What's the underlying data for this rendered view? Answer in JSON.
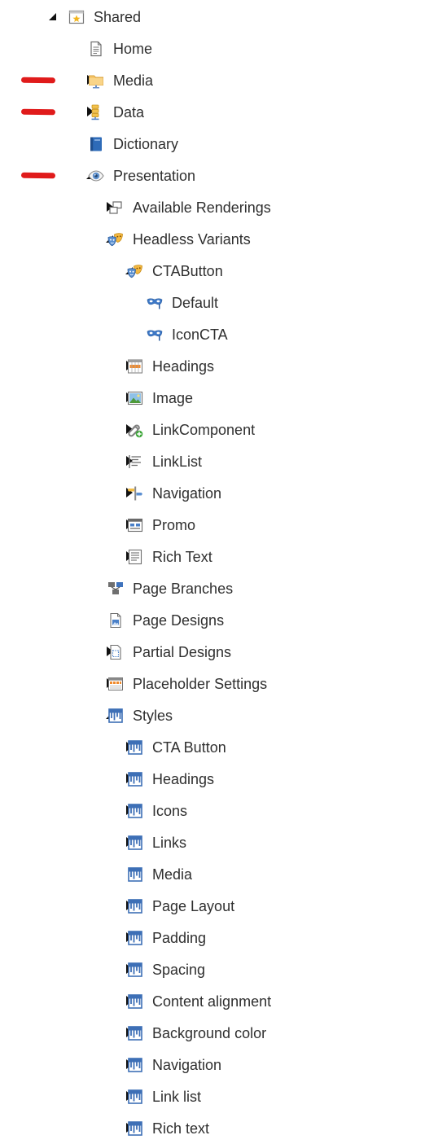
{
  "tree": [
    {
      "label": "Shared",
      "level": 0,
      "state": "expanded",
      "icon": "shared-star-icon"
    },
    {
      "label": "Home",
      "level": 1,
      "state": "none",
      "icon": "document-icon"
    },
    {
      "label": "Media",
      "level": 1,
      "state": "collapsed",
      "icon": "media-folder-icon",
      "marked": true
    },
    {
      "label": "Data",
      "level": 1,
      "state": "collapsed",
      "icon": "data-icon",
      "marked": true
    },
    {
      "label": "Dictionary",
      "level": 1,
      "state": "none",
      "icon": "dictionary-book-icon"
    },
    {
      "label": "Presentation",
      "level": 1,
      "state": "expanded",
      "icon": "eye-icon",
      "marked": true
    },
    {
      "label": "Available Renderings",
      "level": 2,
      "state": "collapsed",
      "icon": "renderings-icon"
    },
    {
      "label": "Headless Variants",
      "level": 2,
      "state": "expanded",
      "icon": "masks-icon"
    },
    {
      "label": "CTAButton",
      "level": 3,
      "state": "expanded",
      "icon": "masks-icon"
    },
    {
      "label": "Default",
      "level": 4,
      "state": "none",
      "icon": "mask-icon"
    },
    {
      "label": "IconCTA",
      "level": 4,
      "state": "none",
      "icon": "mask-icon"
    },
    {
      "label": "Headings",
      "level": 3,
      "state": "collapsed",
      "icon": "headings-icon"
    },
    {
      "label": "Image",
      "level": 3,
      "state": "collapsed",
      "icon": "image-icon"
    },
    {
      "label": "LinkComponent",
      "level": 3,
      "state": "collapsed",
      "icon": "link-add-icon"
    },
    {
      "label": "LinkList",
      "level": 3,
      "state": "collapsed",
      "icon": "list-icon"
    },
    {
      "label": "Navigation",
      "level": 3,
      "state": "collapsed",
      "icon": "signpost-icon"
    },
    {
      "label": "Promo",
      "level": 3,
      "state": "collapsed",
      "icon": "promo-icon"
    },
    {
      "label": "Rich Text",
      "level": 3,
      "state": "collapsed",
      "icon": "rich-text-icon"
    },
    {
      "label": "Page Branches",
      "level": 2,
      "state": "none",
      "icon": "branches-icon"
    },
    {
      "label": "Page Designs",
      "level": 2,
      "state": "none",
      "icon": "page-design-icon"
    },
    {
      "label": "Partial Designs",
      "level": 2,
      "state": "collapsed",
      "icon": "partial-design-icon"
    },
    {
      "label": "Placeholder Settings",
      "level": 2,
      "state": "collapsed",
      "icon": "placeholder-icon"
    },
    {
      "label": "Styles",
      "level": 2,
      "state": "expanded",
      "icon": "style-icon"
    },
    {
      "label": "CTA Button",
      "level": 3,
      "state": "collapsed",
      "icon": "style-icon"
    },
    {
      "label": "Headings",
      "level": 3,
      "state": "collapsed",
      "icon": "style-icon"
    },
    {
      "label": "Icons",
      "level": 3,
      "state": "collapsed",
      "icon": "style-icon"
    },
    {
      "label": "Links",
      "level": 3,
      "state": "collapsed",
      "icon": "style-icon"
    },
    {
      "label": "Media",
      "level": 3,
      "state": "none",
      "icon": "style-icon"
    },
    {
      "label": "Page Layout",
      "level": 3,
      "state": "collapsed",
      "icon": "style-icon"
    },
    {
      "label": "Padding",
      "level": 3,
      "state": "collapsed",
      "icon": "style-icon"
    },
    {
      "label": "Spacing",
      "level": 3,
      "state": "collapsed",
      "icon": "style-icon"
    },
    {
      "label": "Content alignment",
      "level": 3,
      "state": "collapsed",
      "icon": "style-icon"
    },
    {
      "label": "Background color",
      "level": 3,
      "state": "collapsed",
      "icon": "style-icon"
    },
    {
      "label": "Navigation",
      "level": 3,
      "state": "collapsed",
      "icon": "style-icon"
    },
    {
      "label": "Link list",
      "level": 3,
      "state": "collapsed",
      "icon": "style-icon"
    },
    {
      "label": "Rich text",
      "level": 3,
      "state": "collapsed",
      "icon": "style-icon"
    }
  ],
  "colors": {
    "text": "#2f2f2f",
    "marker": "#e01b1b",
    "toggle": "#111111",
    "style_icon_blue": "#3d6fb6"
  }
}
